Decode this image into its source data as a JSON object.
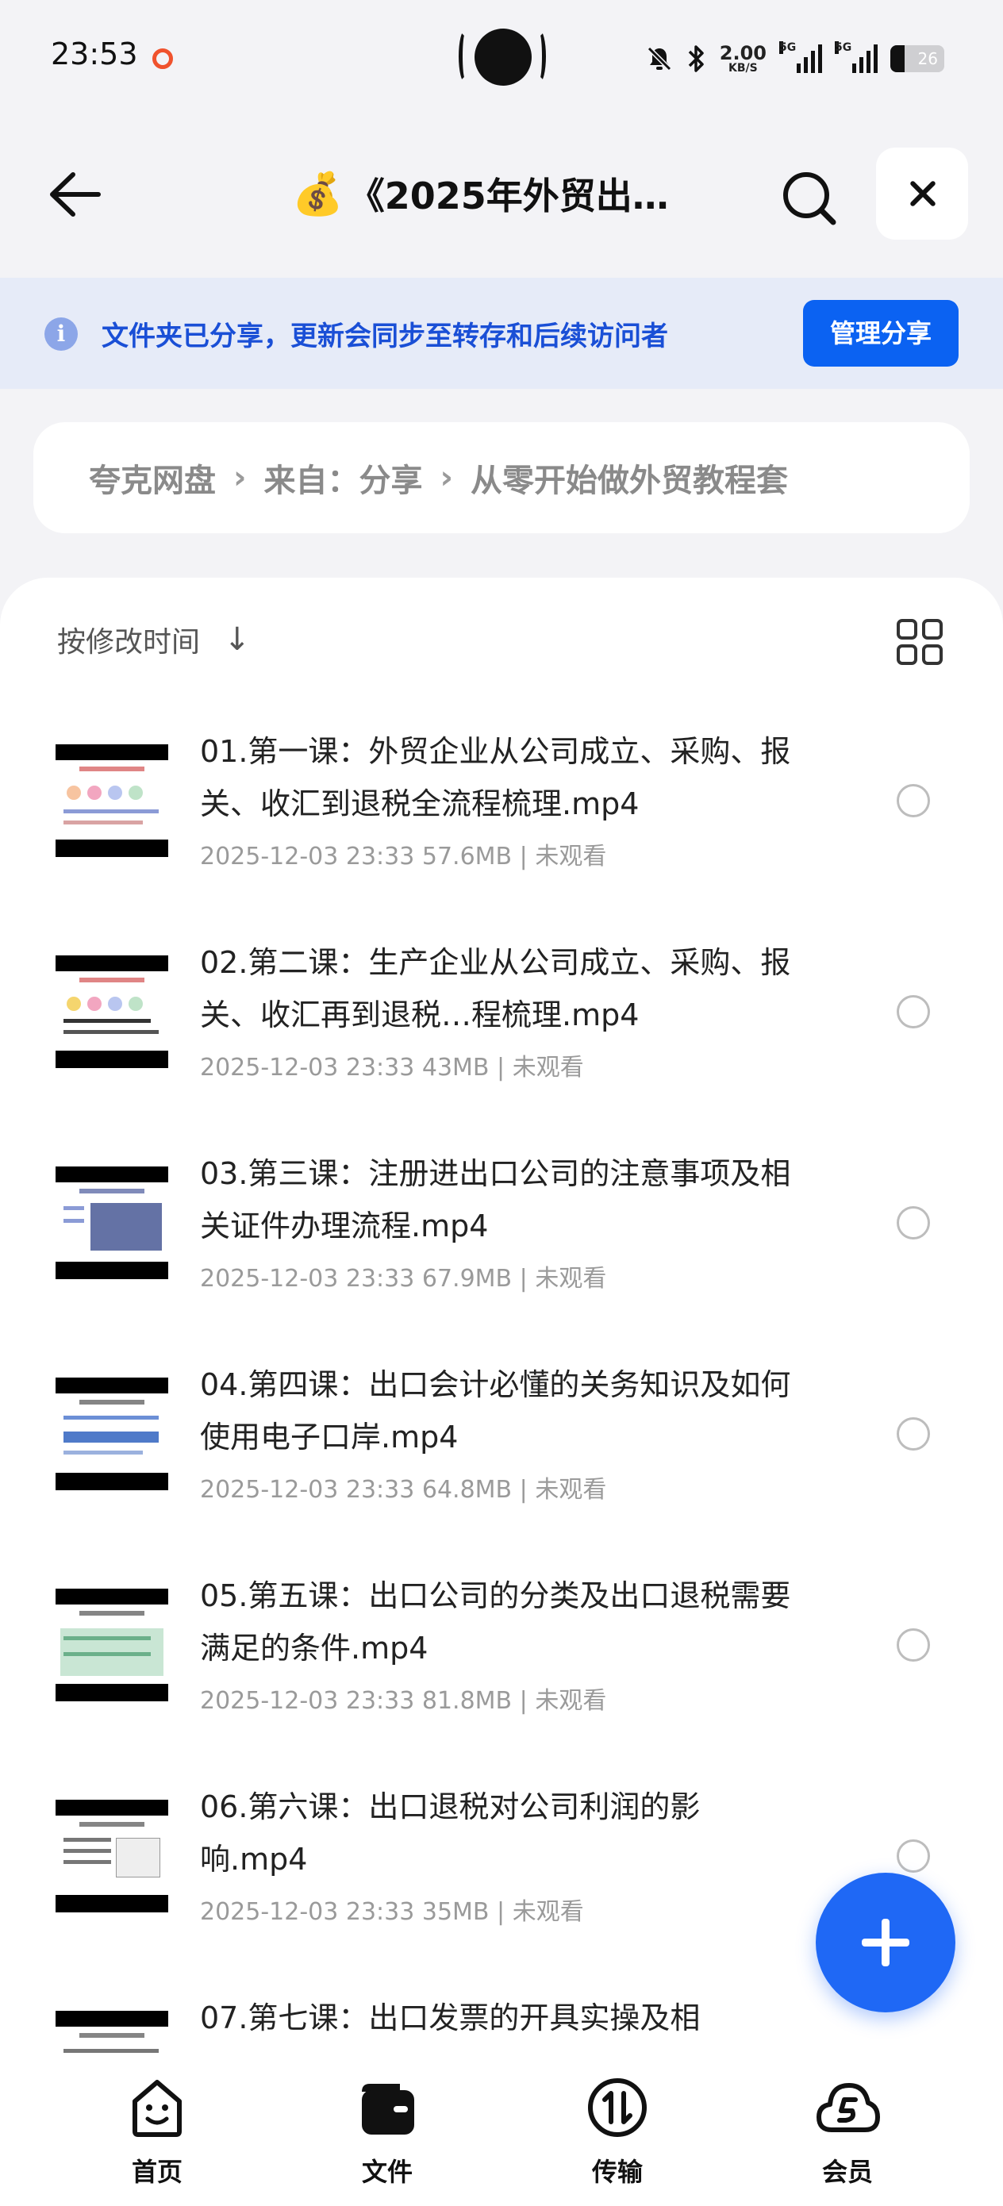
{
  "status_bar": {
    "time": "23:53",
    "speed_value": "2.00",
    "speed_unit": "KB/S",
    "signal1_label": "5G",
    "signal2_label": "5G",
    "battery": "26"
  },
  "header": {
    "title_emoji": "💰",
    "title": "《2025年外贸出…"
  },
  "banner": {
    "text": "文件夹已分享，更新会同步至转存和后续访问者",
    "manage_label": "管理分享"
  },
  "breadcrumb": {
    "items": [
      "夸克网盘",
      "来自：分享",
      "从零开始做外贸教程套"
    ],
    "separator": "›"
  },
  "sort": {
    "label": "按修改时间",
    "arrow": "↓"
  },
  "files": [
    {
      "name": "01.第一课：外贸企业从公司成立、采购、报关、收汇到退税全流程梳理.mp4",
      "meta": "2025-12-03 23:33  57.6MB | 未观看"
    },
    {
      "name": "02.第二课：生产企业从公司成立、采购、报关、收汇再到退税…程梳理.mp4",
      "meta": "2025-12-03 23:33  43MB | 未观看"
    },
    {
      "name": "03.第三课：注册进出口公司的注意事项及相关证件办理流程.mp4",
      "meta": "2025-12-03 23:33  67.9MB | 未观看"
    },
    {
      "name": "04.第四课：出口会计必懂的关务知识及如何使用电子口岸.mp4",
      "meta": "2025-12-03 23:33  64.8MB | 未观看"
    },
    {
      "name": "05.第五课：出口公司的分类及出口退税需要满足的条件.mp4",
      "meta": "2025-12-03 23:33  81.8MB | 未观看"
    },
    {
      "name": "06.第六课：出口退税对公司利润的影响.mp4",
      "meta": "2025-12-03 23:33  35MB | 未观看"
    },
    {
      "name": "07.第七课：出口发票的开具实操及相",
      "meta": ""
    }
  ],
  "tabbar": {
    "home": "首页",
    "files": "文件",
    "transfer": "传输",
    "member": "会员"
  },
  "colors": {
    "accent": "#0b62f2",
    "banner_bg": "#e6ebf8",
    "banner_text": "#1a4fd6"
  }
}
